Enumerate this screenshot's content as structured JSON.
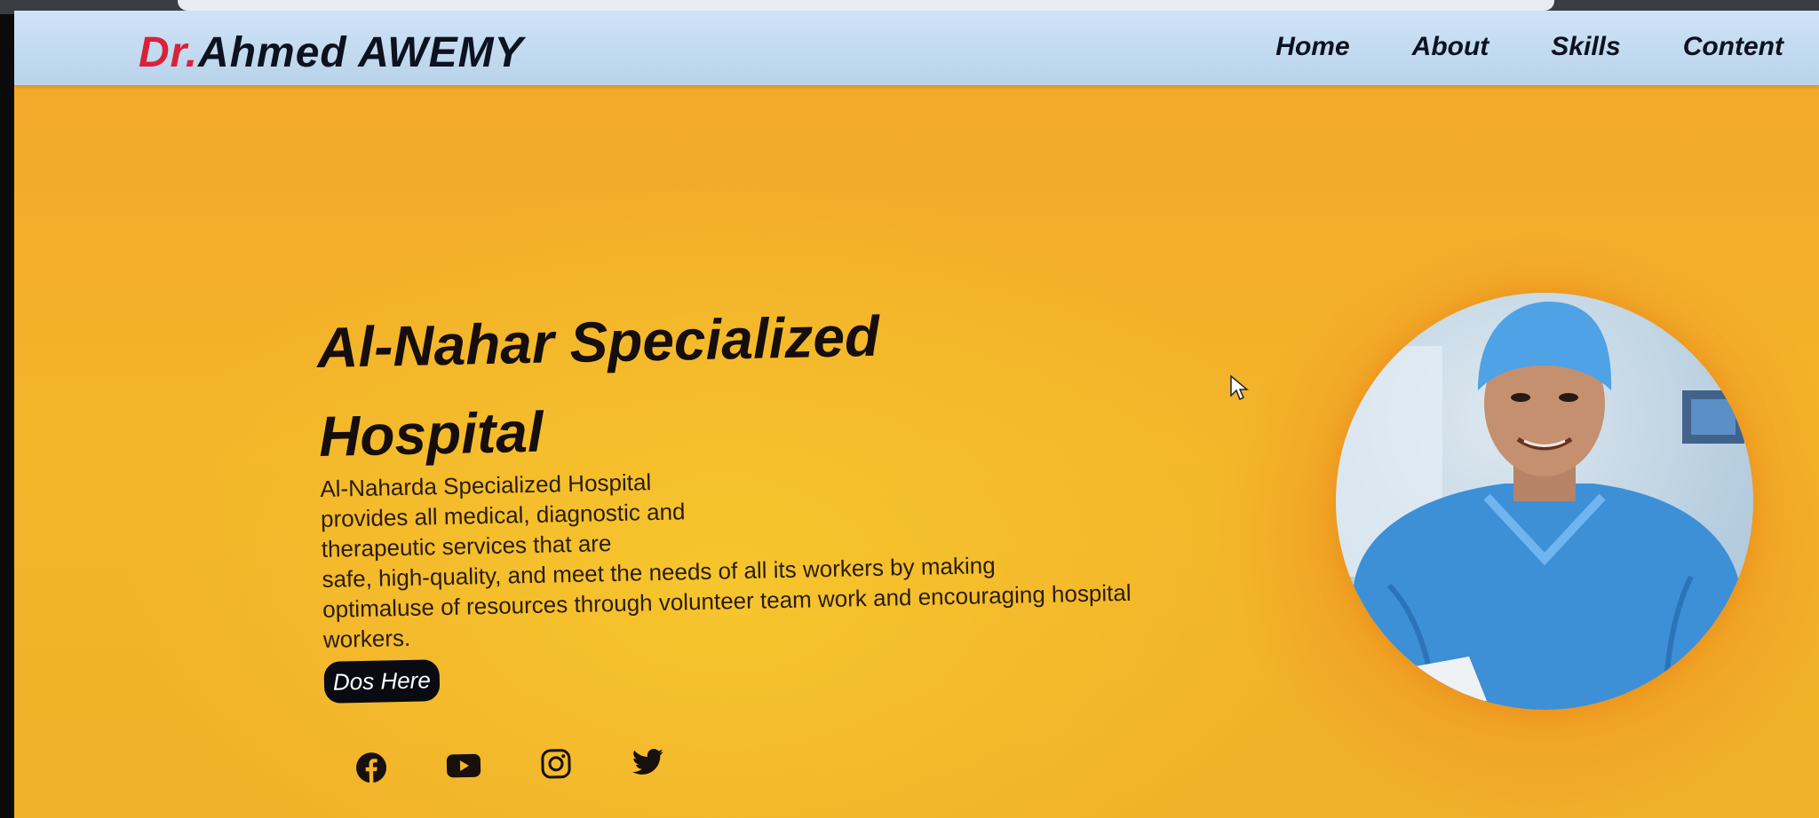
{
  "logo": {
    "prefix": "Dr.",
    "name": "Ahmed AWEMY"
  },
  "nav": {
    "items": [
      "Home",
      "About",
      "Skills",
      "Content"
    ]
  },
  "hero": {
    "title": "Al-Nahar Specialized Hospital",
    "description_lines": [
      "Al-Naharda Specialized Hospital",
      "provides all medical, diagnostic and",
      "therapeutic services that are",
      "safe, high-quality, and meet the needs of all its workers by making",
      "optimaluse of resources through volunteer team work and encouraging hospital",
      "workers."
    ],
    "cta_label": "Dos Here"
  },
  "social": {
    "icons": [
      "facebook-icon",
      "youtube-icon",
      "instagram-icon",
      "twitter-icon"
    ]
  },
  "colors": {
    "nav_bg": "#c5dcf1",
    "brand_red": "#d8223a",
    "hero_bg": "#f3b52a",
    "text_dark": "#150e0c"
  }
}
